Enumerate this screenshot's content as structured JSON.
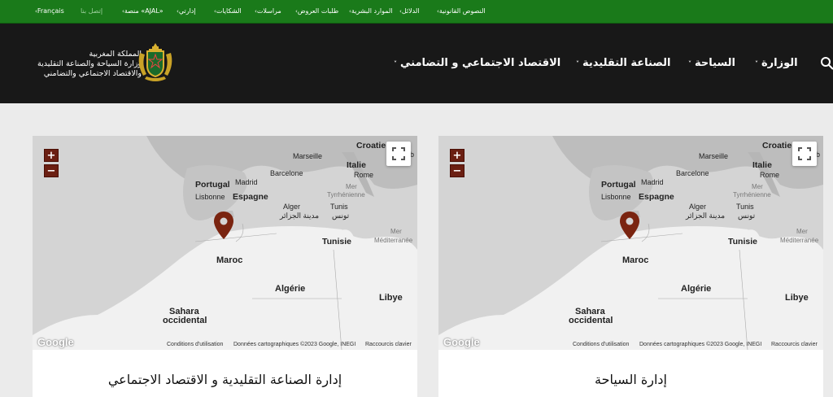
{
  "topbar": {
    "items": [
      {
        "label": "Français",
        "caret": "‹"
      },
      {
        "label": "إتصل بنا",
        "dim": true
      },
      {
        "label": "منصة «AJAL»",
        "caret": "‹"
      },
      {
        "label": "إدارتي",
        "caret": "‹"
      },
      {
        "label": "الشكايات",
        "caret": "‹"
      },
      {
        "label": "مراسلات",
        "caret": "‹"
      },
      {
        "label": "طلبات العروض",
        "caret": "‹"
      },
      {
        "label": "الموارد البشرية",
        "caret": "‹"
      },
      {
        "label": "الدلائل",
        "caret": "‹"
      },
      {
        "label": "النصوص القانونية",
        "caret": "‹"
      }
    ]
  },
  "brand": {
    "line1": "المملكة المغربية",
    "line2": "وزارة السياحة  والصناعة التقليدية",
    "line3": "والاقتصاد الاجتماعي والتضامني"
  },
  "nav": {
    "items": [
      {
        "label": "الاقتصاد الاجتماعي و التضامني"
      },
      {
        "label": "الصناعة التقليدية"
      },
      {
        "label": "السياحة"
      },
      {
        "label": "الوزارة"
      }
    ],
    "chevron": "˅"
  },
  "map": {
    "zoom_in": "+",
    "zoom_out": "−",
    "google": "Google",
    "attr_terms": "Conditions d'utilisation",
    "attr_data": "Données cartographiques ©2023 Google, INEGI",
    "attr_shortcuts": "Raccourcis clavier",
    "labels": {
      "croatie": "Croatie",
      "marseille": "Marseille",
      "italie": "Italie",
      "barcelone": "Barcelone",
      "rome": "Rome",
      "portugal": "Portugal",
      "madrid": "Madrid",
      "lisbonne": "Lisbonne",
      "espagne": "Espagne",
      "mer_tyrr1": "Mer",
      "mer_tyrr2": "Tyrrhénienne",
      "alger": "Alger",
      "alger_ar": "مدينة الجزائر",
      "tunis": "Tunis",
      "tunis_ar": "تونس",
      "tunisie": "Tunisie",
      "mer_med1": "Mer",
      "mer_med2": "Méditerranée",
      "maroc": "Maroc",
      "algerie": "Algérie",
      "libye": "Libye",
      "sahara1": "Sahara",
      "sahara2": "occidental",
      "edge_letter": "b"
    }
  },
  "cards": [
    {
      "title": "إدارة الصناعة التقليدية و الاقتصاد الاجتماعي"
    },
    {
      "title": "إدارة السياحة"
    }
  ],
  "colors": {
    "topbar": "#1a7a1a",
    "header": "#181818",
    "zoom": "#6b1f12",
    "marker": "#7a2410"
  }
}
